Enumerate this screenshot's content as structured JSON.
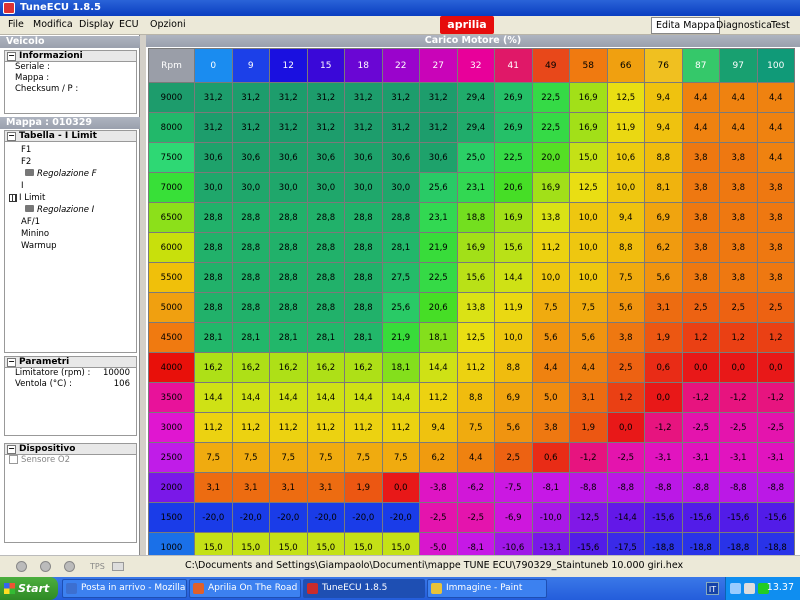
{
  "window": {
    "title": "TuneECU 1.8.5"
  },
  "menu": [
    "File",
    "Modifica",
    "Display",
    "ECU",
    "Opzioni"
  ],
  "brand": "aprilia",
  "top_tabs": [
    {
      "label": "Edita Mappa",
      "active": true
    },
    {
      "label": "Diagnostica",
      "active": false
    },
    {
      "label": "Test",
      "active": false
    }
  ],
  "left": {
    "veicolo_header": "Veicolo",
    "informazioni": {
      "title": "Informazioni",
      "rows": [
        {
          "label": "Seriale :"
        },
        {
          "label": "Mappa :"
        },
        {
          "label": "Checksum / P :"
        }
      ]
    },
    "mappa_header": "Mappa : 010329",
    "tabella": {
      "title": "Tabella - I Limit",
      "items": [
        "F1",
        "F2",
        "Regolazione F",
        "I",
        "I Limit",
        "Regolazione I",
        "AF/1",
        "Minino",
        "Warmup"
      ]
    },
    "parametri": {
      "title": "Parametri",
      "rows": [
        {
          "label": "Limitatore (rpm) :",
          "value": "10000"
        },
        {
          "label": "Ventola (°C) :",
          "value": "106"
        }
      ]
    },
    "dispositivo": {
      "title": "Dispositivo",
      "checkbox_label": "Sensore O2"
    }
  },
  "main": {
    "header": "Carico Motore (%)",
    "corner": "Rpm"
  },
  "chart_data": {
    "type": "table",
    "title": "Carico Motore (%)",
    "columns": [
      "0",
      "9",
      "12",
      "15",
      "18",
      "22",
      "27",
      "32",
      "41",
      "49",
      "58",
      "66",
      "76",
      "87",
      "97",
      "100"
    ],
    "column_colors": [
      "#1a8cf0",
      "#1c40e8",
      "#1a10e0",
      "#3a08d8",
      "#6a06d4",
      "#9a04cc",
      "#c904b8",
      "#e8009a",
      "#e01868",
      "#e8481a",
      "#f07a10",
      "#f0a010",
      "#f0c020",
      "#35c86a",
      "#18a070",
      "#109a78"
    ],
    "rows": [
      {
        "rpm": "9000",
        "values": [
          "31,2",
          "31,2",
          "31,2",
          "31,2",
          "31,2",
          "31,2",
          "31,2",
          "29,4",
          "26,9",
          "22,5",
          "16,9",
          "12,5",
          "9,4",
          "4,4",
          "4,4",
          "4,4"
        ]
      },
      {
        "rpm": "8000",
        "values": [
          "31,2",
          "31,2",
          "31,2",
          "31,2",
          "31,2",
          "31,2",
          "31,2",
          "29,4",
          "26,9",
          "22,5",
          "16,9",
          "11,9",
          "9,4",
          "4,4",
          "4,4",
          "4,4"
        ]
      },
      {
        "rpm": "7500",
        "values": [
          "30,6",
          "30,6",
          "30,6",
          "30,6",
          "30,6",
          "30,6",
          "30,6",
          "25,0",
          "22,5",
          "20,0",
          "15,0",
          "10,6",
          "8,8",
          "3,8",
          "3,8",
          "4,4"
        ]
      },
      {
        "rpm": "7000",
        "values": [
          "30,0",
          "30,0",
          "30,0",
          "30,0",
          "30,0",
          "30,0",
          "25,6",
          "23,1",
          "20,6",
          "16,9",
          "12,5",
          "10,0",
          "8,1",
          "3,8",
          "3,8",
          "3,8"
        ]
      },
      {
        "rpm": "6500",
        "values": [
          "28,8",
          "28,8",
          "28,8",
          "28,8",
          "28,8",
          "28,8",
          "23,1",
          "18,8",
          "16,9",
          "13,8",
          "10,0",
          "9,4",
          "6,9",
          "3,8",
          "3,8",
          "3,8"
        ]
      },
      {
        "rpm": "6000",
        "values": [
          "28,8",
          "28,8",
          "28,8",
          "28,8",
          "28,8",
          "28,1",
          "21,9",
          "16,9",
          "15,6",
          "11,2",
          "10,0",
          "8,8",
          "6,2",
          "3,8",
          "3,8",
          "3,8"
        ]
      },
      {
        "rpm": "5500",
        "values": [
          "28,8",
          "28,8",
          "28,8",
          "28,8",
          "28,8",
          "27,5",
          "22,5",
          "15,6",
          "14,4",
          "10,0",
          "10,0",
          "7,5",
          "5,6",
          "3,8",
          "3,8",
          "3,8"
        ]
      },
      {
        "rpm": "5000",
        "values": [
          "28,8",
          "28,8",
          "28,8",
          "28,8",
          "28,8",
          "25,6",
          "20,6",
          "13,8",
          "11,9",
          "7,5",
          "7,5",
          "5,6",
          "3,1",
          "2,5",
          "2,5",
          "2,5"
        ]
      },
      {
        "rpm": "4500",
        "values": [
          "28,1",
          "28,1",
          "28,1",
          "28,1",
          "28,1",
          "21,9",
          "18,1",
          "12,5",
          "10,0",
          "5,6",
          "5,6",
          "3,8",
          "1,9",
          "1,2",
          "1,2",
          "1,2"
        ]
      },
      {
        "rpm": "4000",
        "values": [
          "16,2",
          "16,2",
          "16,2",
          "16,2",
          "16,2",
          "18,1",
          "14,4",
          "11,2",
          "8,8",
          "4,4",
          "4,4",
          "2,5",
          "0,6",
          "0,0",
          "0,0",
          "0,0"
        ]
      },
      {
        "rpm": "3500",
        "values": [
          "14,4",
          "14,4",
          "14,4",
          "14,4",
          "14,4",
          "14,4",
          "11,2",
          "8,8",
          "6,9",
          "5,0",
          "3,1",
          "1,2",
          "0,0",
          "-1,2",
          "-1,2",
          "-1,2"
        ]
      },
      {
        "rpm": "3000",
        "values": [
          "11,2",
          "11,2",
          "11,2",
          "11,2",
          "11,2",
          "11,2",
          "9,4",
          "7,5",
          "5,6",
          "3,8",
          "1,9",
          "0,0",
          "-1,2",
          "-2,5",
          "-2,5",
          "-2,5"
        ]
      },
      {
        "rpm": "2500",
        "values": [
          "7,5",
          "7,5",
          "7,5",
          "7,5",
          "7,5",
          "7,5",
          "6,2",
          "4,4",
          "2,5",
          "0,6",
          "-1,2",
          "-2,5",
          "-3,1",
          "-3,1",
          "-3,1",
          "-3,1"
        ]
      },
      {
        "rpm": "2000",
        "values": [
          "3,1",
          "3,1",
          "3,1",
          "3,1",
          "1,9",
          "0,0",
          "-3,8",
          "-6,2",
          "-7,5",
          "-8,1",
          "-8,8",
          "-8,8",
          "-8,8",
          "-8,8",
          "-8,8",
          "-8,8"
        ]
      },
      {
        "rpm": "1500",
        "values": [
          "-20,0",
          "-20,0",
          "-20,0",
          "-20,0",
          "-20,0",
          "-20,0",
          "-2,5",
          "-2,5",
          "-6,9",
          "-10,0",
          "-12,5",
          "-14,4",
          "-15,6",
          "-15,6",
          "-15,6",
          "-15,6"
        ]
      },
      {
        "rpm": "1000",
        "values": [
          "15,0",
          "15,0",
          "15,0",
          "15,0",
          "15,0",
          "15,0",
          "-5,0",
          "-8,1",
          "-10,6",
          "-13,1",
          "-15,6",
          "-17,5",
          "-18,8",
          "-18,8",
          "-18,8",
          "-18,8"
        ]
      }
    ],
    "rpm_colors": [
      "#1d9c6c",
      "#22b86a",
      "#2ed874",
      "#38e038",
      "#8ce01a",
      "#c8e00c",
      "#f0c00a",
      "#f0a010",
      "#f07a10",
      "#e8100a",
      "#e8129a",
      "#e016d0",
      "#c01ce8",
      "#7a18e8",
      "#1a3ce8",
      "#1a70e8"
    ]
  },
  "status": {
    "tps_label": "TPS",
    "path": "C:\\Documents and Settings\\Giampaolo\\Documenti\\mappe TUNE ECU\\790329_Staintuneb  10.000 giri.hex"
  },
  "taskbar": {
    "start": "Start",
    "tasks": [
      {
        "label": "Posta in arrivo - Mozilla T...",
        "color": "#3c6fd0"
      },
      {
        "label": "Aprilia On The Road • Le...",
        "color": "#e0602a"
      },
      {
        "label": "TuneECU 1.8.5",
        "color": "#c92c2c"
      },
      {
        "label": "Immagine - Paint",
        "color": "#e8c23a"
      }
    ],
    "lang": "IT",
    "clock": "13.37"
  }
}
